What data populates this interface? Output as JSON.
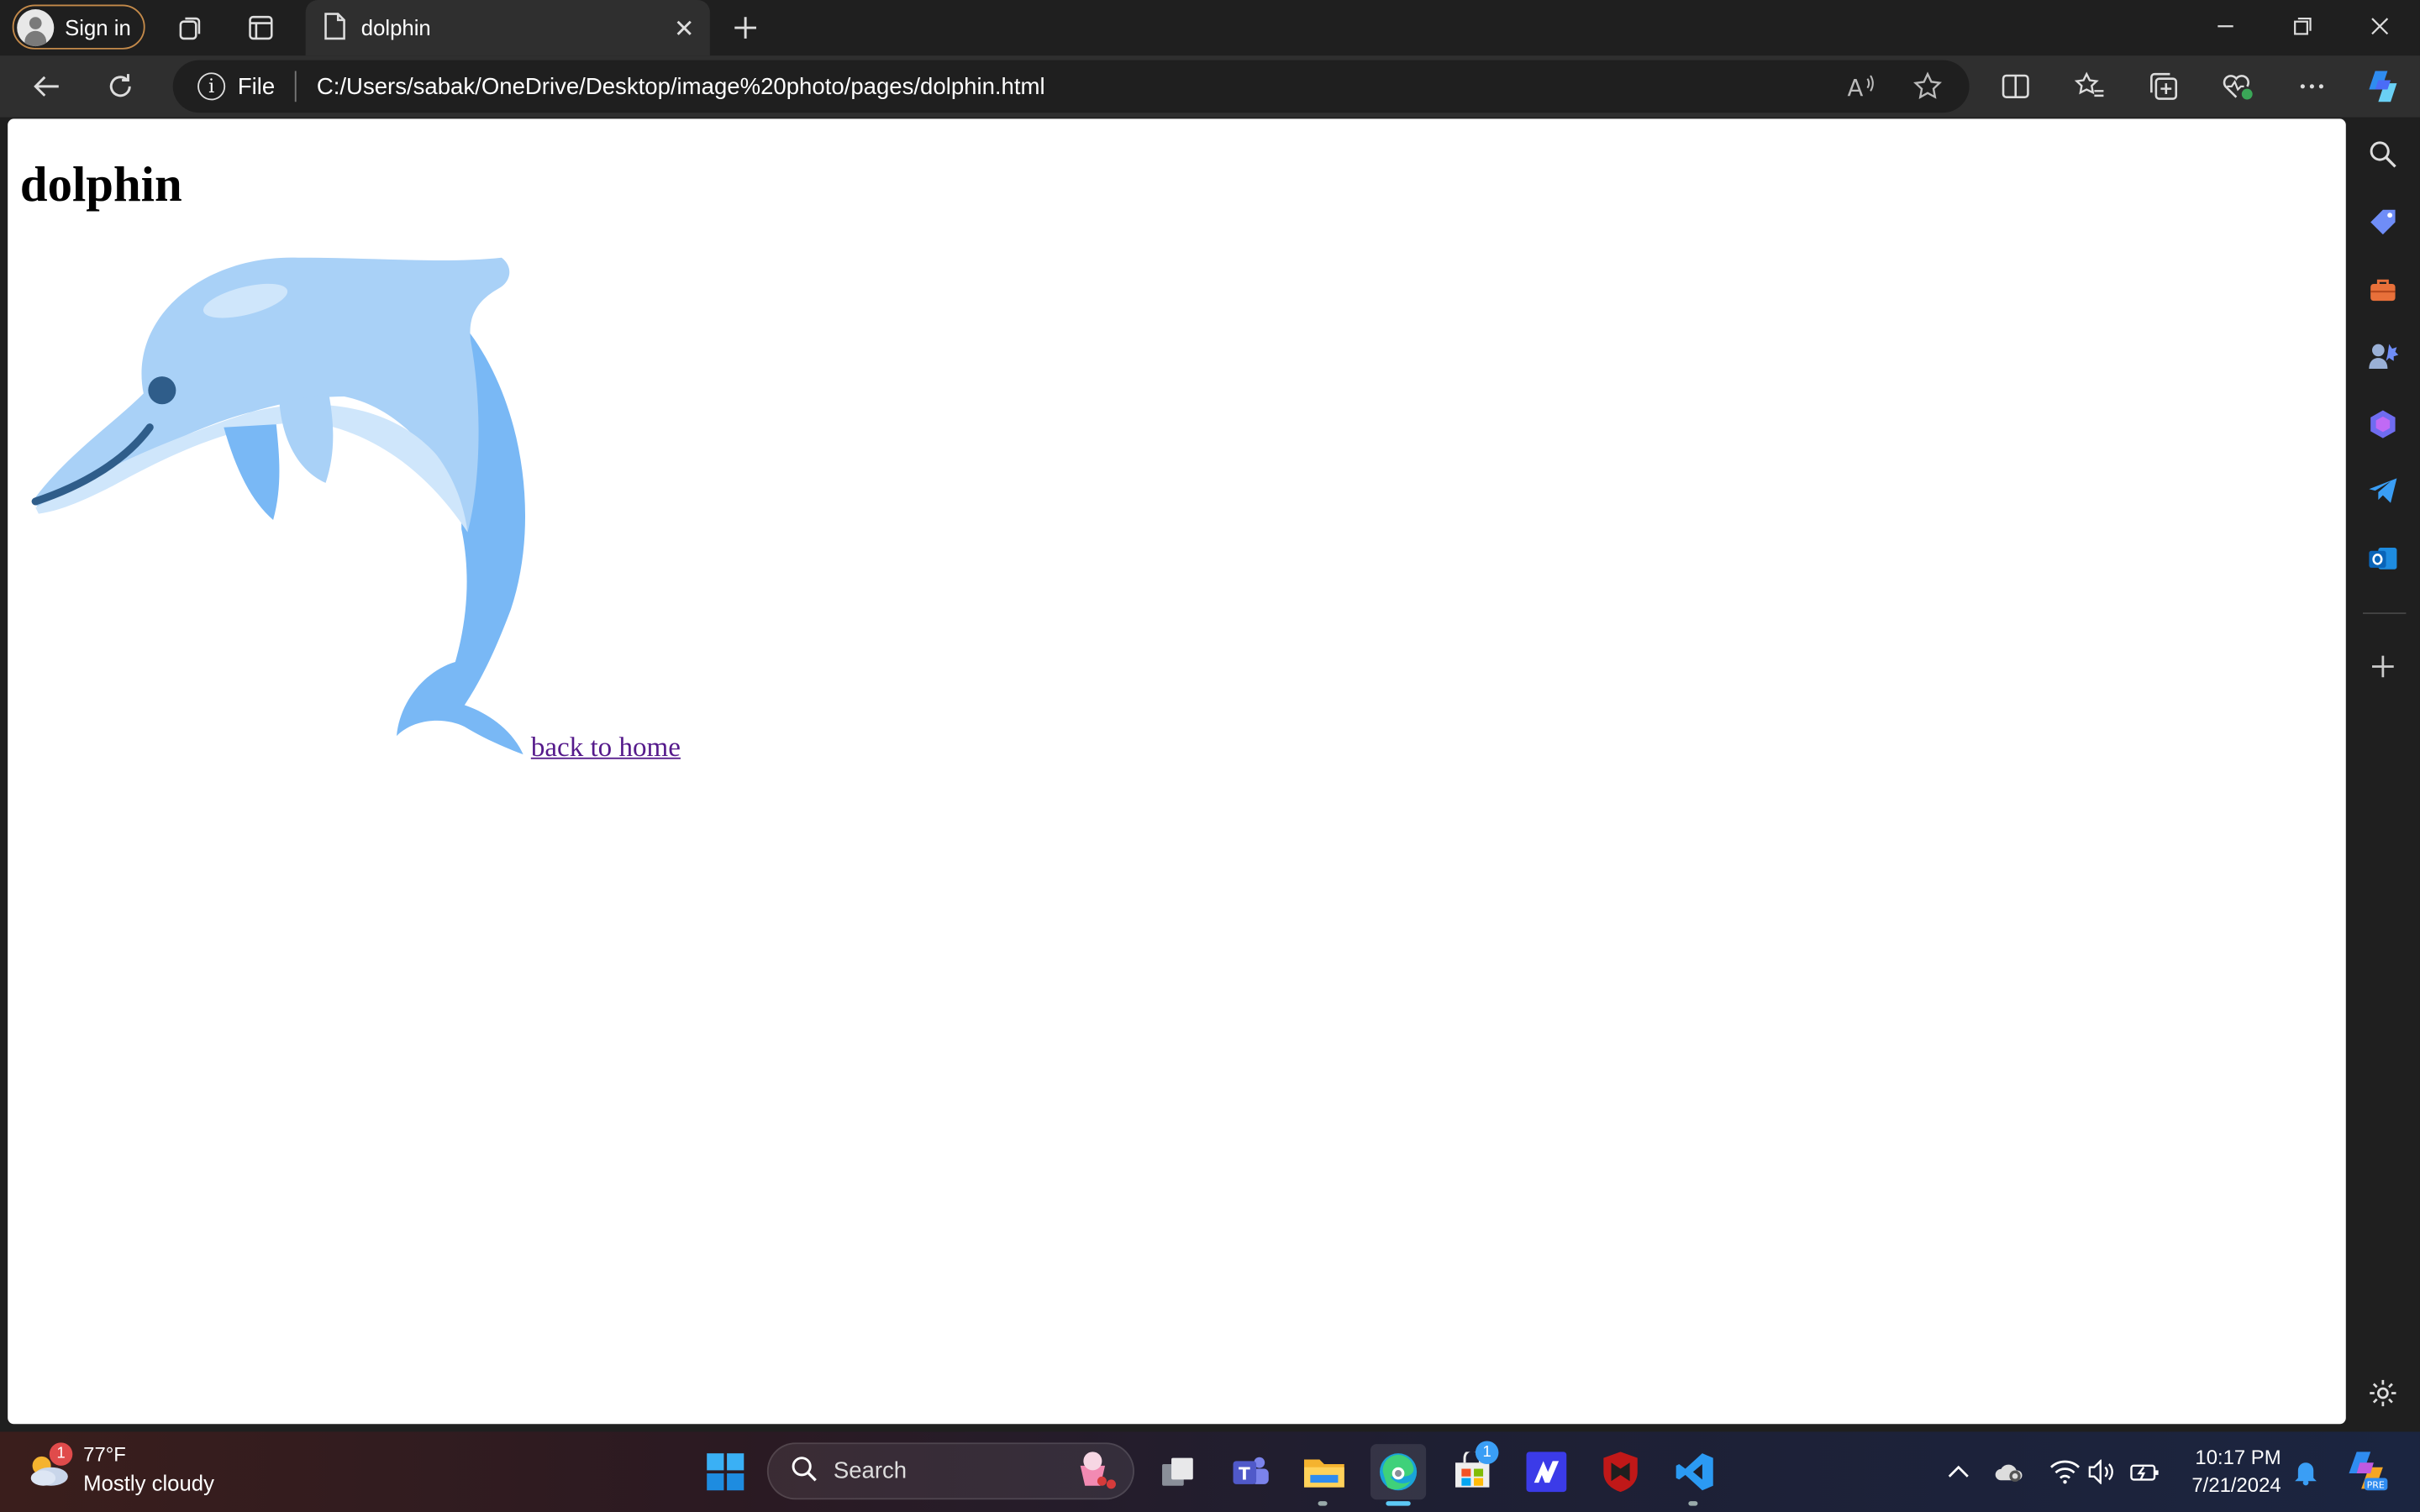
{
  "browser": {
    "profile_label": "Sign in",
    "tab_title": "dolphin",
    "address_scheme": "File",
    "url": "C:/Users/sabak/OneDrive/Desktop/image%20photo/pages/dolphin.html"
  },
  "page": {
    "heading": "dolphin",
    "link_text": "back to home",
    "image_subject": "dolphin"
  },
  "taskbar": {
    "weather_temp": "77°F",
    "weather_condition": "Mostly cloudy",
    "weather_badge": "1",
    "search_placeholder": "Search",
    "store_badge": "1",
    "time": "10:17 PM",
    "date": "7/21/2024"
  },
  "colors": {
    "dolphin_light": "#a9d1f7",
    "dolphin_mid": "#79b8f5",
    "dolphin_dark": "#2f5d8a",
    "visited_link": "#551a8b",
    "profile_border": "#c48a4a"
  }
}
